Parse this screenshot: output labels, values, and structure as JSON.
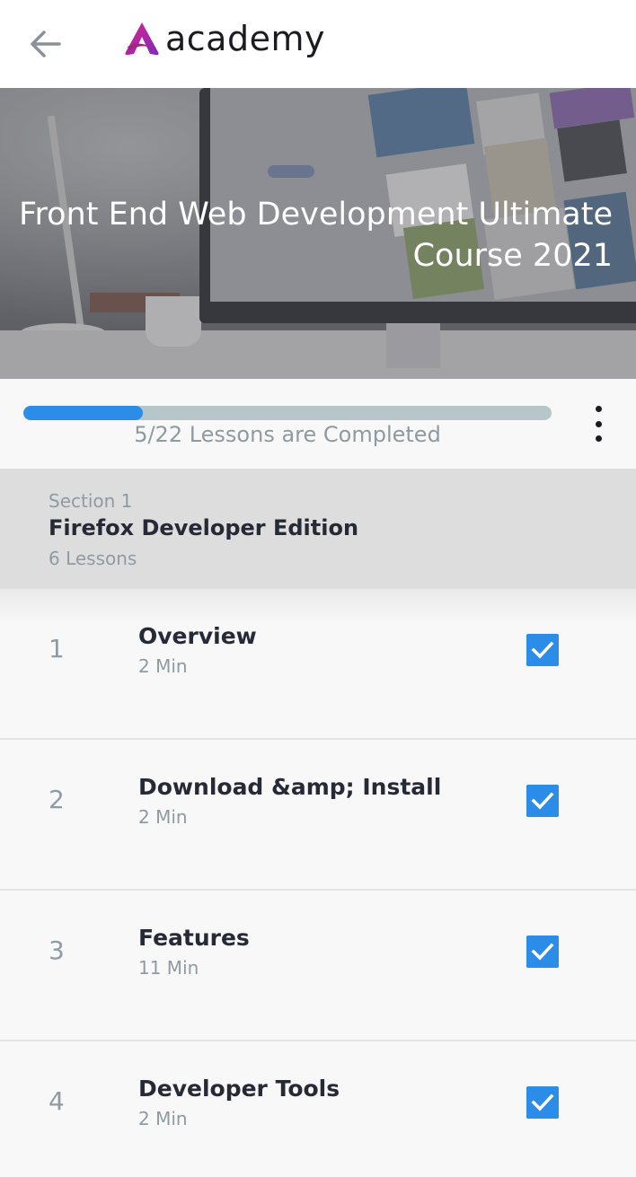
{
  "header": {
    "brand": "academy"
  },
  "hero": {
    "title": "Front End Web Development Ultimate Course 2021"
  },
  "progress": {
    "completed": 5,
    "total": 22,
    "fraction": 0.227,
    "text": "5/22 Lessons are Completed"
  },
  "section": {
    "label": "Section 1",
    "title": "Firefox Developer Edition",
    "lessons_count": "6 Lessons"
  },
  "lessons": [
    {
      "number": "1",
      "title": "Overview",
      "duration": "2 Min",
      "completed": true
    },
    {
      "number": "2",
      "title": "Download &amp; Install",
      "duration": "2 Min",
      "completed": true
    },
    {
      "number": "3",
      "title": "Features",
      "duration": "11 Min",
      "completed": true
    },
    {
      "number": "4",
      "title": "Developer Tools",
      "duration": "2 Min",
      "completed": true
    }
  ],
  "icons": {
    "back": "arrow-left-icon",
    "more": "more-vertical-icon",
    "check": "checkbox-checked-icon"
  },
  "colors": {
    "accent": "#2b8de8",
    "track": "#b6c6c9",
    "logo_start": "#e0218a",
    "logo_end": "#7b2cbf"
  }
}
